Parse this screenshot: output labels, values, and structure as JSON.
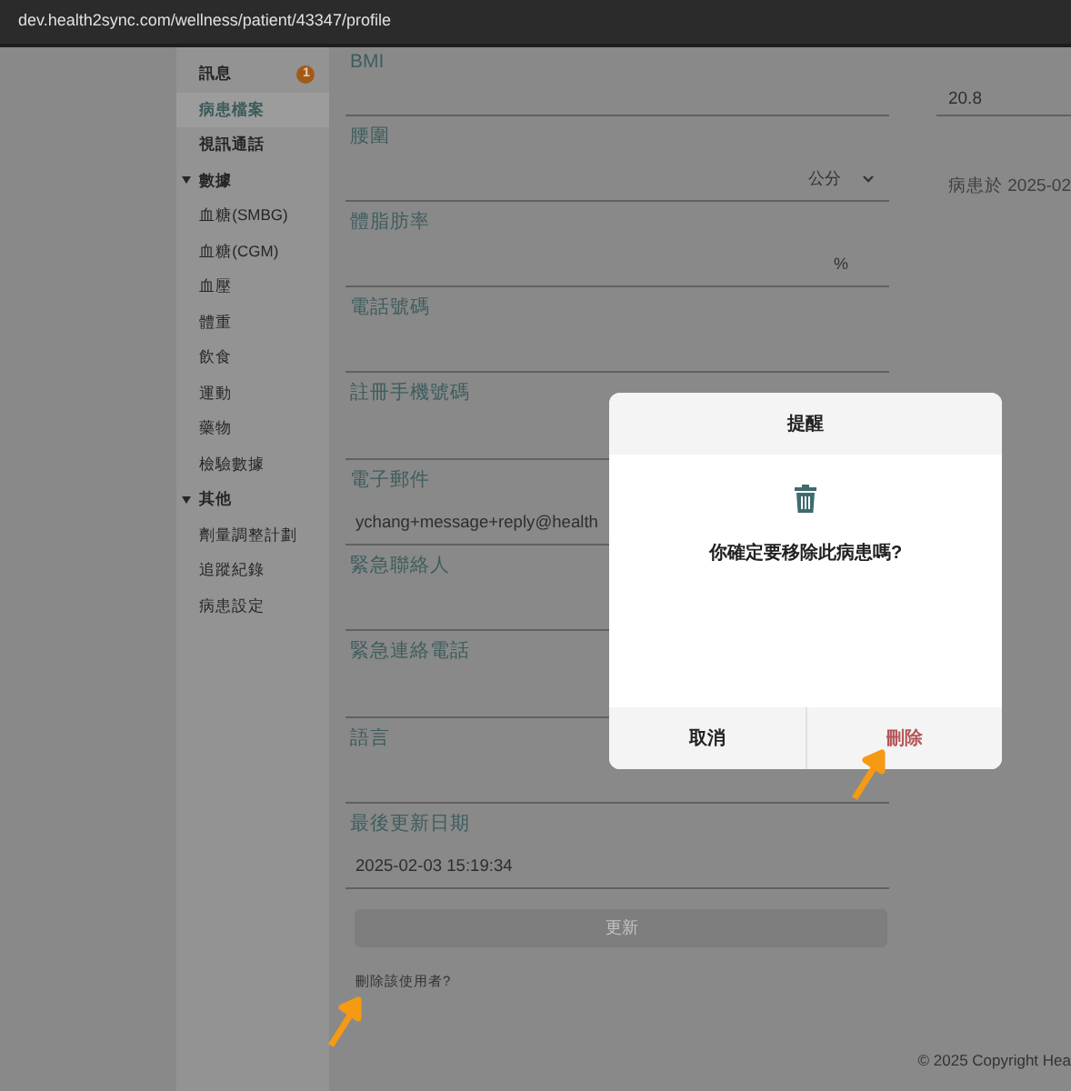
{
  "address_bar": {
    "url": "dev.health2sync.com/wellness/patient/43347/profile"
  },
  "sidebar": {
    "items": [
      {
        "kind": "link",
        "label": "訊息",
        "badge": "1",
        "selected": false
      },
      {
        "kind": "link",
        "label": "病患檔案",
        "selected": true
      },
      {
        "kind": "link",
        "label": "視訊通話",
        "selected": false
      },
      {
        "kind": "group",
        "label": "數據",
        "expanded": true,
        "children": [
          {
            "label": "血糖(SMBG)",
            "selected": false
          },
          {
            "label": "血糖(CGM)",
            "selected": false
          },
          {
            "label": "血壓",
            "selected": false
          },
          {
            "label": "體重",
            "selected": false
          },
          {
            "label": "飲食",
            "selected": false
          },
          {
            "label": "運動",
            "selected": false
          },
          {
            "label": "藥物",
            "selected": false
          },
          {
            "label": "檢驗數據",
            "selected": false
          }
        ]
      },
      {
        "kind": "group",
        "label": "其他",
        "expanded": true,
        "children": [
          {
            "label": "劑量調整計劃",
            "selected": false
          },
          {
            "label": "追蹤紀錄",
            "selected": false
          },
          {
            "label": "病患設定",
            "selected": false
          }
        ]
      }
    ]
  },
  "form": {
    "fields": [
      {
        "label": "BMI"
      },
      {
        "label": "腰圍",
        "unit": "公分",
        "dropdown": true
      },
      {
        "label": "體脂肪率",
        "unit": "%"
      },
      {
        "label": "電話號碼"
      },
      {
        "label": "註冊手機號碼"
      },
      {
        "label": "電子郵件",
        "value": "ychang+message+reply@health"
      },
      {
        "label": "緊急聯絡人"
      },
      {
        "label": "緊急連絡電話"
      },
      {
        "label": "語言"
      },
      {
        "label": "最後更新日期",
        "value": "2025-02-03 15:19:34"
      }
    ],
    "update_button": {
      "label": "更新",
      "disabled": true
    },
    "delete_link": "刪除該使用者?"
  },
  "side_info": {
    "bmi_value": "20.8",
    "note": "病患於 2025-02"
  },
  "footer": "© 2025 Copyright Hea",
  "dialog": {
    "title": "提醒",
    "message": "你確定要移除此病患嗎?",
    "buttons": [
      {
        "kind": "cancel",
        "label": "取消"
      },
      {
        "kind": "danger",
        "label": "刪除"
      }
    ]
  }
}
